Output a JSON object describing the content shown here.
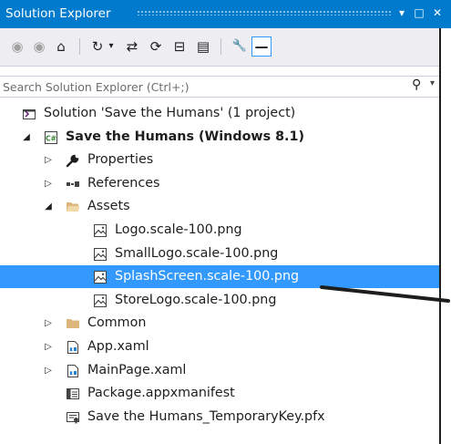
{
  "window": {
    "title": "Solution Explorer",
    "pin_glyph": "▾",
    "maximize_glyph": "□",
    "close_glyph": "✕"
  },
  "toolbar": {
    "buttons": [
      {
        "name": "back-icon",
        "glyph": "◉"
      },
      {
        "name": "forward-icon",
        "glyph": "◉"
      },
      {
        "name": "home-icon",
        "glyph": "⌂"
      },
      {
        "name": "history-icon",
        "glyph": "↻"
      },
      {
        "name": "dropdown-caret-icon",
        "glyph": "▾"
      },
      {
        "name": "sync-icon",
        "glyph": "⇄"
      },
      {
        "name": "refresh-icon",
        "glyph": "⟳"
      },
      {
        "name": "collapse-all-icon",
        "glyph": "⊟"
      },
      {
        "name": "show-all-files-icon",
        "glyph": "▤"
      },
      {
        "name": "properties-wrench-icon",
        "glyph": "🔧"
      },
      {
        "name": "preview-selected-items-icon",
        "glyph": "—"
      }
    ]
  },
  "search": {
    "placeholder": "Search Solution Explorer (Ctrl+;)",
    "value": "",
    "icon_glyph": "⚲",
    "caret_glyph": "▾"
  },
  "tree": {
    "items": [
      {
        "label": "Solution 'Save the Humans' (1 project)",
        "level": 0,
        "expander": "",
        "icon": "solution-icon",
        "bold": false,
        "selected": false
      },
      {
        "label": "Save the Humans (Windows 8.1)",
        "level": 1,
        "expander": "◢",
        "icon": "csharp-project-icon",
        "bold": true,
        "selected": false
      },
      {
        "label": "Properties",
        "level": 2,
        "expander": "▷",
        "icon": "wrench-icon",
        "bold": false,
        "selected": false
      },
      {
        "label": "References",
        "level": 2,
        "expander": "▷",
        "icon": "references-icon",
        "bold": false,
        "selected": false
      },
      {
        "label": "Assets",
        "level": 2,
        "expander": "◢",
        "icon": "folder-open-icon",
        "bold": false,
        "selected": false
      },
      {
        "label": "Logo.scale-100.png",
        "level": 3,
        "expander": "",
        "icon": "image-file-icon",
        "bold": false,
        "selected": false
      },
      {
        "label": "SmallLogo.scale-100.png",
        "level": 3,
        "expander": "",
        "icon": "image-file-icon",
        "bold": false,
        "selected": false
      },
      {
        "label": "SplashScreen.scale-100.png",
        "level": 3,
        "expander": "",
        "icon": "image-file-icon",
        "bold": false,
        "selected": true
      },
      {
        "label": "StoreLogo.scale-100.png",
        "level": 3,
        "expander": "",
        "icon": "image-file-icon",
        "bold": false,
        "selected": false
      },
      {
        "label": "Common",
        "level": 2,
        "expander": "▷",
        "icon": "folder-icon",
        "bold": false,
        "selected": false
      },
      {
        "label": "App.xaml",
        "level": 2,
        "expander": "▷",
        "icon": "xaml-file-icon",
        "bold": false,
        "selected": false
      },
      {
        "label": "MainPage.xaml",
        "level": 2,
        "expander": "▷",
        "icon": "xaml-file-icon",
        "bold": false,
        "selected": false
      },
      {
        "label": "Package.appxmanifest",
        "level": 2,
        "expander": "",
        "icon": "manifest-icon",
        "bold": false,
        "selected": false
      },
      {
        "label": "Save the Humans_TemporaryKey.pfx",
        "level": 2,
        "expander": "",
        "icon": "certificate-icon",
        "bold": false,
        "selected": false
      }
    ]
  },
  "colors": {
    "accent": "#007acc",
    "selection": "#3399ff",
    "folder": "#dcb67a",
    "toolbar_bg": "#eeeef2"
  }
}
